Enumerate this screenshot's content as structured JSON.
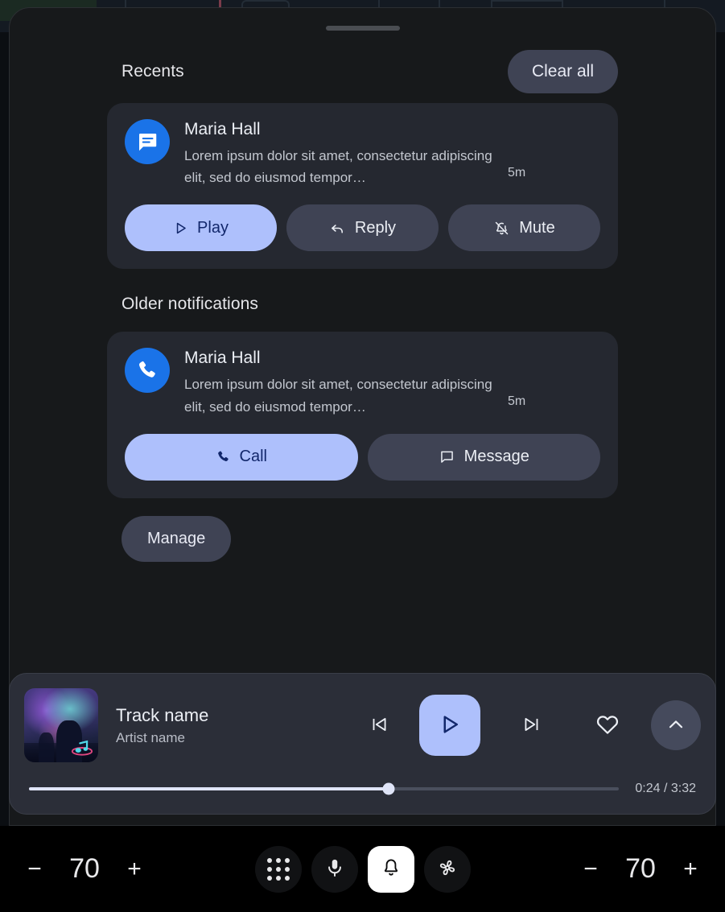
{
  "panel": {
    "drag_handle": "drag-handle"
  },
  "recents": {
    "title": "Recents",
    "clear_all_label": "Clear all"
  },
  "older": {
    "title": "Older notifications"
  },
  "notifications": [
    {
      "icon": "message-icon",
      "sender": "Maria Hall",
      "body": "Lorem ipsum dolor sit amet, consectetur adipiscing elit, sed do eiusmod tempor…",
      "time": "5m",
      "actions": [
        {
          "label": "Play",
          "icon": "play-icon",
          "style": "primary"
        },
        {
          "label": "Reply",
          "icon": "reply-icon",
          "style": "secondary"
        },
        {
          "label": "Mute",
          "icon": "mute-icon",
          "style": "secondary"
        }
      ]
    },
    {
      "icon": "phone-icon",
      "sender": "Maria Hall",
      "body": "Lorem ipsum dolor sit amet, consectetur adipiscing elit, sed do eiusmod tempor…",
      "time": "5m",
      "actions": [
        {
          "label": "Call",
          "icon": "phone-icon",
          "style": "primary"
        },
        {
          "label": "Message",
          "icon": "message-icon",
          "style": "secondary"
        }
      ]
    }
  ],
  "manage": {
    "label": "Manage"
  },
  "media": {
    "track": "Track name",
    "artist": "Artist name",
    "album_art": "concert-photo",
    "controls": {
      "previous": "previous-track-icon",
      "play": "play-icon",
      "next": "next-track-icon",
      "favorite": "heart-icon",
      "expand": "chevron-up-icon"
    },
    "progress": {
      "elapsed": "0:24",
      "duration": "3:32",
      "time_display": "0:24 / 3:32",
      "percent": 61
    }
  },
  "toolbar": {
    "left_temp": {
      "decrease": "−",
      "value": "70",
      "increase": "+"
    },
    "right_temp": {
      "decrease": "−",
      "value": "70",
      "increase": "+"
    },
    "center": [
      {
        "icon": "apps-grid-icon",
        "active": false
      },
      {
        "icon": "microphone-icon",
        "active": false
      },
      {
        "icon": "notification-bell-icon",
        "active": true
      },
      {
        "icon": "fan-icon",
        "active": false
      }
    ]
  },
  "colors": {
    "accent": "#aec0fc",
    "accent_text": "#12276b",
    "panel_bg": "#17191b",
    "card_bg": "#252830",
    "secondary_btn": "#3f4354",
    "media_bg": "#2b2e38",
    "toolbar_bg": "#000000",
    "avatar_blue": "#1a73e8"
  }
}
